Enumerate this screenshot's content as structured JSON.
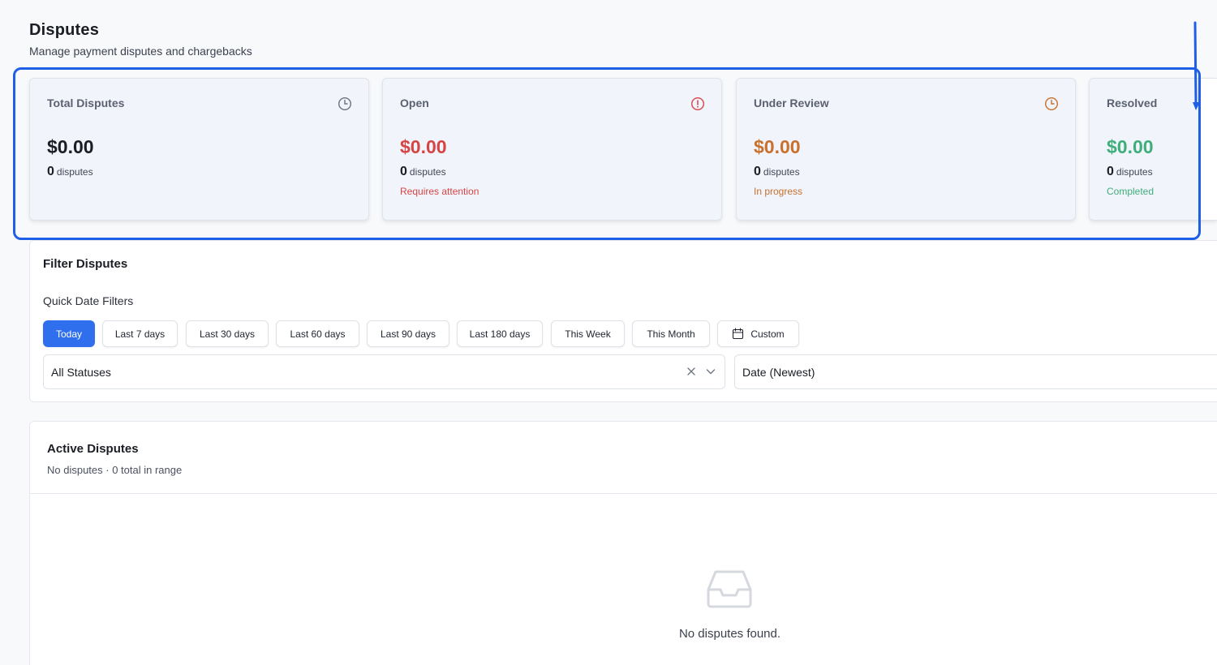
{
  "header": {
    "title": "Disputes",
    "subtitle": "Manage payment disputes and chargebacks"
  },
  "stats": [
    {
      "label": "Total Disputes",
      "amount": "$0.00",
      "count": "0",
      "count_unit": "disputes",
      "note": "",
      "icon": "clock-icon",
      "color": "#1a1d24"
    },
    {
      "label": "Open",
      "amount": "$0.00",
      "count": "0",
      "count_unit": "disputes",
      "note": "Requires attention",
      "icon": "alert-circle-icon",
      "color": "#d64545"
    },
    {
      "label": "Under Review",
      "amount": "$0.00",
      "count": "0",
      "count_unit": "disputes",
      "note": "In progress",
      "icon": "clock-icon",
      "color": "#c9702c"
    },
    {
      "label": "Resolved",
      "amount": "$0.00",
      "count": "0",
      "count_unit": "disputes",
      "note": "Completed",
      "icon": "check-icon",
      "color": "#3fae7a"
    }
  ],
  "filters": {
    "title": "Filter Disputes",
    "quick_label": "Quick Date Filters",
    "quick_options": [
      "Today",
      "Last 7 days",
      "Last 30 days",
      "Last 60 days",
      "Last 90 days",
      "Last 180 days",
      "This Week",
      "This Month",
      "Custom"
    ],
    "active_option": "Today",
    "status_value": "All Statuses",
    "sort_value": "Date (Newest)"
  },
  "list": {
    "title": "Active Disputes",
    "subtitle": "No disputes · 0 total in range",
    "empty_text": "No disputes found."
  },
  "colors": {
    "accent": "#2f6fed",
    "highlight": "#1f5fe8"
  }
}
